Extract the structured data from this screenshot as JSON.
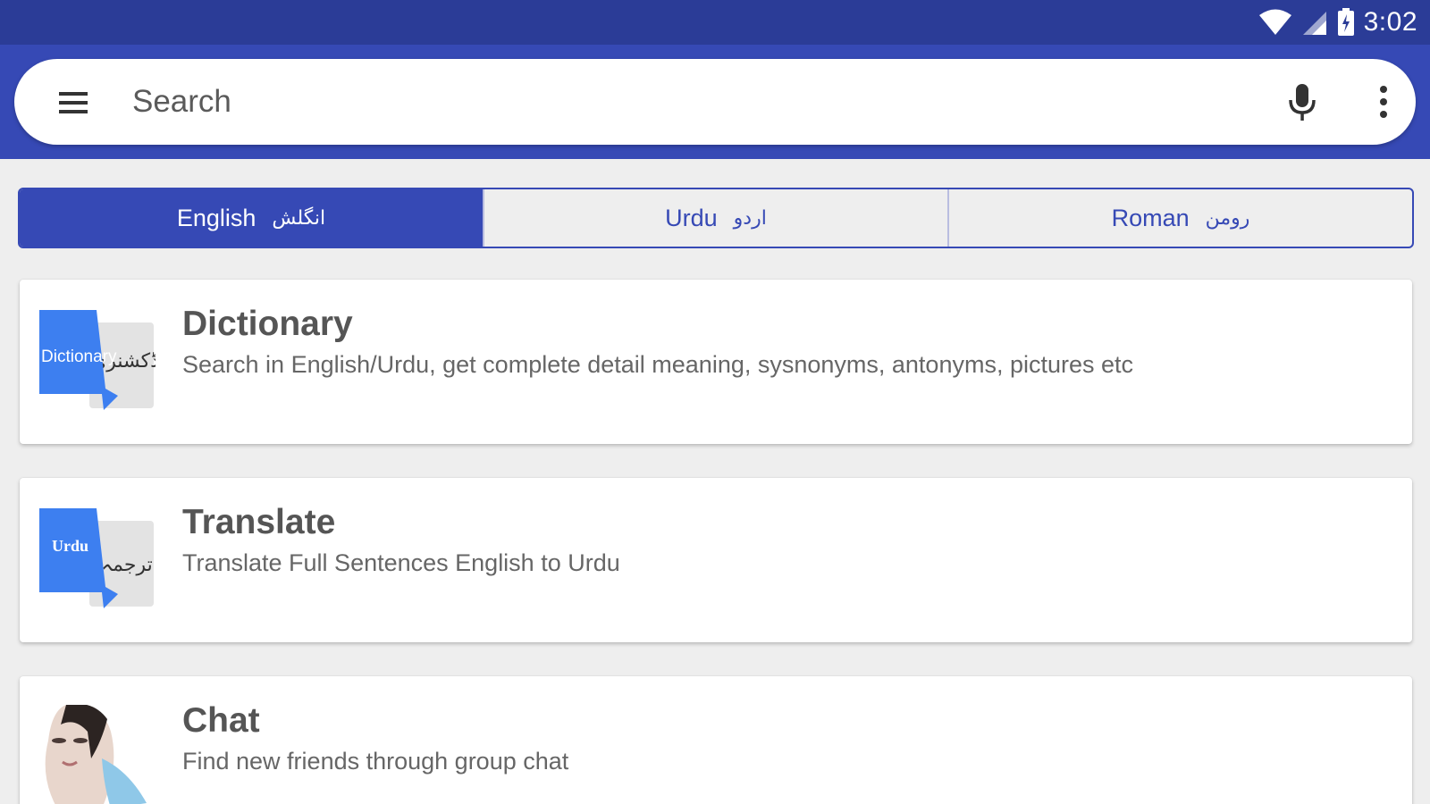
{
  "status_bar": {
    "time": "3:02",
    "icons": [
      "wifi-icon",
      "signal-icon",
      "battery-charging-icon"
    ]
  },
  "search": {
    "placeholder": "Search",
    "value": "",
    "menu_icon": "hamburger-menu-icon",
    "mic_icon": "microphone-icon",
    "more_icon": "more-vertical-icon"
  },
  "language_tabs": [
    {
      "label": "English",
      "urdu_label": "انگلش",
      "active": true
    },
    {
      "label": "Urdu",
      "urdu_label": "اردو",
      "active": false
    },
    {
      "label": "Roman",
      "urdu_label": "رومن",
      "active": false
    }
  ],
  "cards": [
    {
      "title": "Dictionary",
      "description": "Search in English/Urdu, get complete detail meaning, sysnonyms, antonyms, pictures etc",
      "icon": "dictionary-icon",
      "icon_text": "Dictionary",
      "icon_urdu": "ڈکشنری"
    },
    {
      "title": "Translate",
      "description": "Translate Full Sentences English to Urdu",
      "icon": "translate-icon",
      "icon_text": "Urdu",
      "icon_urdu": "ترجمہ"
    },
    {
      "title": "Chat",
      "description": "Find new friends through group chat",
      "icon": "chat-avatar-icon"
    }
  ],
  "colors": {
    "status_bar": "#2b3c97",
    "primary": "#3649b5",
    "background": "#eeeeee",
    "icon_blue": "#3d7ff0"
  }
}
